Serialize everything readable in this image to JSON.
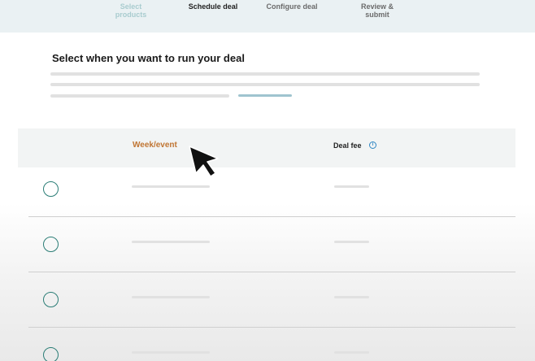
{
  "stepper": {
    "steps": [
      {
        "label": "Select products",
        "state": "done"
      },
      {
        "label": "Schedule deal",
        "state": "current"
      },
      {
        "label": "Configure deal",
        "state": "todo"
      },
      {
        "label_line1": "Review &",
        "label_line2": "submit",
        "state": "todo"
      }
    ]
  },
  "page": {
    "heading": "Select when you want to run your deal"
  },
  "table": {
    "headers": {
      "week": "Week/event",
      "fee": "Deal fee"
    },
    "info_icon_glyph": "i",
    "row_count": 4
  },
  "colors": {
    "stepbar_bg": "#eaf1f3",
    "accent_orange": "#c07533",
    "radio_teal": "#2b7d76",
    "info_blue": "#2f86c3"
  },
  "icons": [
    "info-icon",
    "mouse-cursor-icon"
  ]
}
